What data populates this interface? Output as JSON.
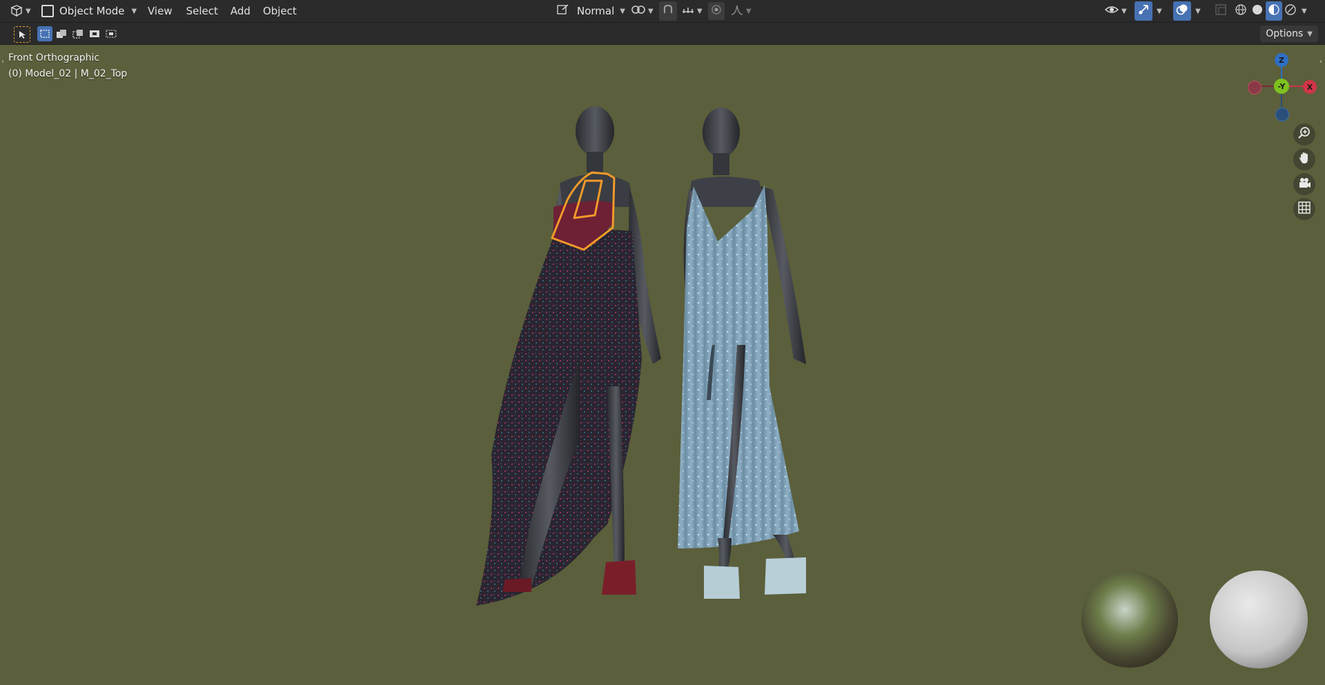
{
  "header": {
    "editor_type_icon": "viewport-3d-icon",
    "mode_label": "Object Mode",
    "menus": [
      "View",
      "Select",
      "Add",
      "Object"
    ],
    "transform_orientation": "Normal"
  },
  "viewport": {
    "view_name": "Front Orthographic",
    "object_info": "(0) Model_02 | M_02_Top",
    "background_color": "#5b5f3b"
  },
  "gizmo": {
    "z_label": "Z",
    "y_label": "-Y",
    "x_label": "X",
    "z_color": "#2f6fc4",
    "y_color": "#7ec11f",
    "x_color": "#d03547"
  },
  "toolbar": {
    "options_label": "Options"
  },
  "colors": {
    "accent": "#4772b3",
    "selection_outline": "#f39a2a"
  }
}
